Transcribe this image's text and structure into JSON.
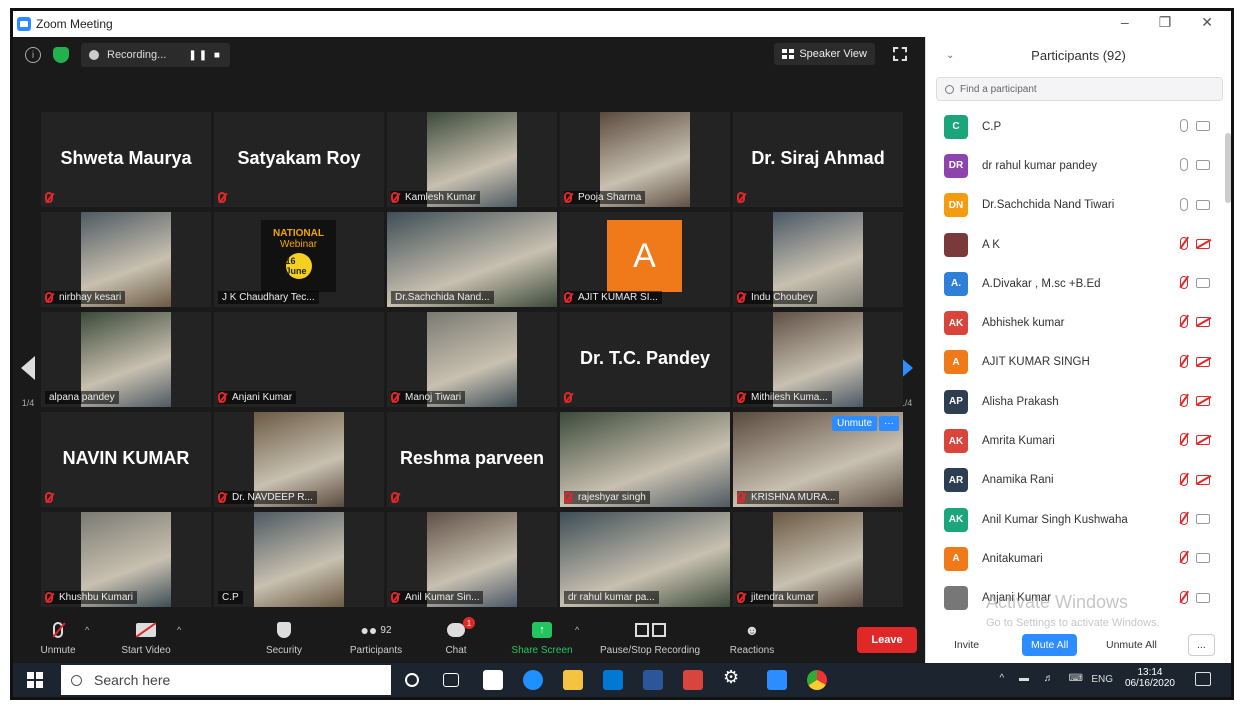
{
  "window": {
    "title": "Zoom Meeting"
  },
  "topbar": {
    "recording_label": "Recording...",
    "speaker_view_label": "Speaker View"
  },
  "page_indicator": "1/4",
  "tiles": [
    {
      "name": "Shweta Maurya",
      "label": "",
      "big": true
    },
    {
      "name": "Satyakam Roy",
      "label": "",
      "big": true
    },
    {
      "name": "",
      "label": "Kamlesh Kumar",
      "video": true
    },
    {
      "name": "",
      "label": "Pooja Sharma",
      "video": true
    },
    {
      "name": "Dr. Siraj Ahmad",
      "label": "",
      "big": true
    },
    {
      "name": "",
      "label": "nirbhay kesari",
      "video": true
    },
    {
      "name": "",
      "label": "J K Chaudhary Tec...",
      "video": true,
      "nomic": true
    },
    {
      "name": "",
      "label": "Dr.Sachchida Nand...",
      "video": true,
      "nomic": true
    },
    {
      "name": "",
      "label": "AJIT KUMAR SI...",
      "video": true
    },
    {
      "name": "",
      "label": "Indu Choubey",
      "video": true
    },
    {
      "name": "",
      "label": "alpana pandey",
      "video": true,
      "nomic": true
    },
    {
      "name": "",
      "label": "Anjani Kumar",
      "video": false
    },
    {
      "name": "",
      "label": "Manoj Tiwari",
      "video": true
    },
    {
      "name": "Dr. T.C. Pandey",
      "label": "",
      "big": true
    },
    {
      "name": "",
      "label": "Mithilesh Kuma...",
      "video": true
    },
    {
      "name": "NAVIN KUMAR",
      "label": "",
      "big": true
    },
    {
      "name": "",
      "label": "Dr. NAVDEEP R...",
      "video": true
    },
    {
      "name": "Reshma parveen",
      "label": "",
      "big": true
    },
    {
      "name": "",
      "label": "rajeshyar singh",
      "video": true
    },
    {
      "name": "",
      "label": "KRISHNA MURA...",
      "video": true
    },
    {
      "name": "",
      "label": "Khushbu Kumari",
      "video": true
    },
    {
      "name": "",
      "label": "C.P",
      "video": true,
      "nomic": true
    },
    {
      "name": "",
      "label": "Anil Kumar Sin...",
      "video": true
    },
    {
      "name": "",
      "label": "dr rahul kumar pa...",
      "video": true,
      "nomic": true,
      "active": true
    },
    {
      "name": "",
      "label": "jitendra kumar",
      "video": true
    }
  ],
  "webinar_logo": {
    "line1": "NATIONAL",
    "line2": "Webinar",
    "line3": "16 June"
  },
  "ajit_avatar_letter": "A",
  "unmute_badge": "Unmute",
  "more_badge": "···",
  "toolbar": {
    "unmute": "Unmute",
    "start_video": "Start Video",
    "security": "Security",
    "participants": "Participants",
    "participants_count": "92",
    "chat": "Chat",
    "share_screen": "Share Screen",
    "pause_stop": "Pause/Stop Recording",
    "reactions": "Reactions",
    "leave": "Leave"
  },
  "panel": {
    "title": "Participants (92)",
    "search_placeholder": "Find a participant",
    "participants": [
      {
        "initials": "C",
        "name": "C.P",
        "color": "#1aa67a",
        "mic": "on",
        "cam": "on"
      },
      {
        "initials": "DR",
        "name": "dr rahul kumar pandey",
        "color": "#8e44ad",
        "mic": "on",
        "cam": "on"
      },
      {
        "initials": "DN",
        "name": "Dr.Sachchida Nand Tiwari",
        "color": "#f39c12",
        "mic": "on",
        "cam": "on"
      },
      {
        "initials": "",
        "name": "A K",
        "color": "#7b3a3a",
        "mic": "off",
        "cam": "off"
      },
      {
        "initials": "A.",
        "name": "A.Divakar , M.sc +B.Ed",
        "color": "#2d7fd8",
        "mic": "off",
        "cam": "on"
      },
      {
        "initials": "AK",
        "name": "Abhishek kumar",
        "color": "#d9453b",
        "mic": "off",
        "cam": "off"
      },
      {
        "initials": "A",
        "name": "AJIT KUMAR SINGH",
        "color": "#f07a1a",
        "mic": "off",
        "cam": "off"
      },
      {
        "initials": "AP",
        "name": "Alisha Prakash",
        "color": "#2c3e50",
        "mic": "off",
        "cam": "off"
      },
      {
        "initials": "AK",
        "name": "Amrita Kumari",
        "color": "#d9453b",
        "mic": "off",
        "cam": "off"
      },
      {
        "initials": "AR",
        "name": "Anamika Rani",
        "color": "#2c3e50",
        "mic": "off",
        "cam": "off"
      },
      {
        "initials": "AK",
        "name": "Anil Kumar Singh Kushwaha",
        "color": "#1aa67a",
        "mic": "off",
        "cam": "on"
      },
      {
        "initials": "A",
        "name": "Anitakumari",
        "color": "#f07a1a",
        "mic": "off",
        "cam": "on"
      },
      {
        "initials": "",
        "name": "Anjani Kumar",
        "color": "#777",
        "mic": "off",
        "cam": "on"
      }
    ],
    "invite": "Invite",
    "mute_all": "Mute All",
    "unmute_all": "Unmute All",
    "more": "...",
    "watermark_line1": "Activate Windows",
    "watermark_line2": "Go to Settings to activate Windows."
  },
  "taskbar": {
    "search_placeholder": "Search here",
    "lang": "ENG",
    "time": "13:14",
    "date": "06/16/2020"
  }
}
